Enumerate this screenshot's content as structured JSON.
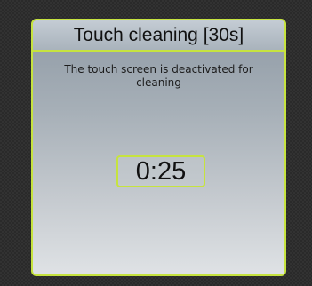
{
  "dialog": {
    "title": "Touch cleaning [30s]",
    "message": "The touch screen is deactivated for cleaning",
    "countdown": "0:25"
  },
  "colors": {
    "accent": "#c6e33f",
    "background": "#2a2a2a",
    "panel_top": "#8f9aa5",
    "panel_bottom": "#dfe2e5",
    "text": "#111111"
  }
}
